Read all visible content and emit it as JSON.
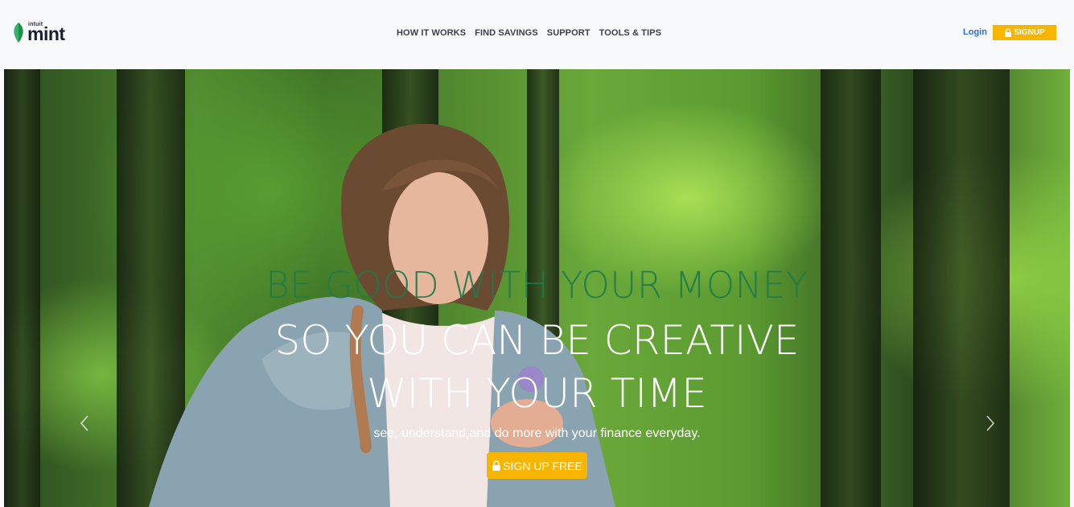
{
  "brand": {
    "top_text": "intuit",
    "name": "mint"
  },
  "nav": {
    "items": [
      {
        "label": "HOW IT WORKS"
      },
      {
        "label": "FIND SAVINGS"
      },
      {
        "label": "SUPPORT"
      },
      {
        "label": "TOOLS & TIPS"
      }
    ]
  },
  "auth": {
    "login_label": "Login",
    "signup_label": "SIGNUP"
  },
  "hero": {
    "headline_primary": "BE GOOD WITH YOUR MONEY",
    "headline_secondary_line1": "SO YOU CAN BE CREATIVE",
    "headline_secondary_line2": "WITH YOUR TIME",
    "subline": "see, understand,and do more with your finance everyday.",
    "cta_label": "SIGN UP FREE"
  },
  "icons": {
    "logo": "mint-leaf-icon",
    "lock": "lock-icon",
    "prev": "chevron-left-icon",
    "next": "chevron-right-icon"
  },
  "colors": {
    "accent": "#f7b500",
    "link": "#2b6fd6",
    "headline_green": "#1f7a4c",
    "header_bg": "#f8f9fb"
  }
}
